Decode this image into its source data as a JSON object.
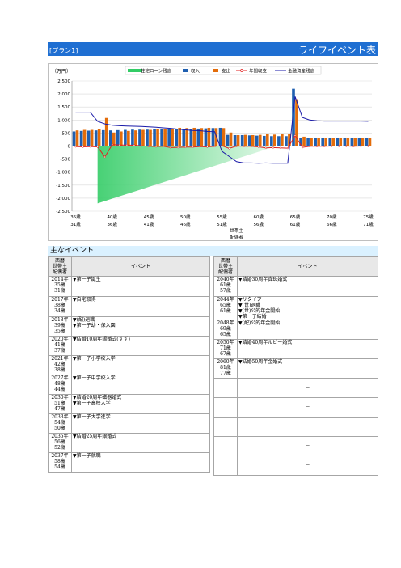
{
  "header": {
    "plan": "[プラン1]",
    "title": "ライフイベント表"
  },
  "chart_data": {
    "type": "bar",
    "yunit": "（万円）",
    "ylim": [
      -2500,
      2500
    ],
    "yticks": [
      "2,500",
      "2,000",
      "1,500",
      "1,000",
      "500",
      "0",
      "-500",
      "-1,000",
      "-1,500",
      "-2,000",
      "-2,500"
    ],
    "x_ticks_row1": [
      "35歳",
      "40歳",
      "45歳",
      "50歳",
      "55歳",
      "60歳",
      "65歳",
      "70歳",
      "75歳"
    ],
    "x_ticks_row2": [
      "31歳",
      "36歳",
      "41歳",
      "46歳",
      "51歳",
      "56歳",
      "61歳",
      "66歳",
      "71歳"
    ],
    "x_axis_label": [
      "世帯主",
      "配偶者"
    ],
    "legend": [
      "住宅ローン残高",
      "収入",
      "支出",
      "年間収支",
      "金融資産残高"
    ],
    "colors": {
      "loan": "#33cc66",
      "income": "#1f5fb0",
      "expense": "#e36c0a",
      "balance": "#e02020",
      "assets": "#1a1aa8"
    },
    "ages": [
      35,
      36,
      37,
      38,
      39,
      40,
      41,
      42,
      43,
      44,
      45,
      46,
      47,
      48,
      49,
      50,
      51,
      52,
      53,
      54,
      55,
      56,
      57,
      58,
      59,
      60,
      61,
      62,
      63,
      64,
      65,
      66,
      67,
      68,
      69,
      70,
      71,
      72,
      73,
      74,
      75
    ],
    "series": [
      {
        "name": "収入",
        "values": [
          560,
          580,
          590,
          600,
          610,
          600,
          610,
          620,
          630,
          630,
          630,
          640,
          640,
          650,
          650,
          660,
          660,
          670,
          680,
          690,
          700,
          430,
          420,
          420,
          410,
          400,
          390,
          380,
          380,
          380,
          2200,
          310,
          300,
          300,
          300,
          300,
          300,
          300,
          300,
          300,
          300
        ]
      },
      {
        "name": "支出",
        "values": [
          600,
          620,
          620,
          640,
          1080,
          520,
          560,
          580,
          600,
          620,
          620,
          640,
          640,
          680,
          700,
          690,
          700,
          690,
          700,
          690,
          690,
          520,
          420,
          430,
          420,
          430,
          460,
          440,
          450,
          460,
          1800,
          360,
          310,
          310,
          310,
          300,
          300,
          300,
          310,
          300,
          300
        ]
      },
      {
        "name": "年間収支",
        "values": [
          -20,
          -30,
          -20,
          -30,
          -420,
          60,
          40,
          40,
          30,
          10,
          -10,
          -20,
          -10,
          -60,
          -50,
          -40,
          -40,
          -20,
          -30,
          -10,
          10,
          -90,
          0,
          -10,
          -10,
          -30,
          -70,
          -60,
          -70,
          -80,
          400,
          -50,
          -10,
          -10,
          -10,
          0,
          0,
          0,
          -10,
          0,
          0
        ]
      },
      {
        "name": "金融資産残高",
        "values": [
          1300,
          1300,
          1300,
          950,
          850,
          800,
          780,
          770,
          760,
          750,
          740,
          720,
          700,
          680,
          650,
          620,
          600,
          590,
          560,
          550,
          -200,
          -400,
          -600,
          -650,
          -650,
          -660,
          -650,
          -660,
          -660,
          -660,
          1900,
          1100,
          1000,
          970,
          960,
          960,
          960,
          960,
          960,
          960,
          950
        ]
      },
      {
        "name": "住宅ローン残高",
        "values": [
          0,
          0,
          0,
          -2200,
          -2110,
          -2020,
          -1930,
          -1840,
          -1750,
          -1660,
          -1570,
          -1480,
          -1390,
          -1300,
          -1210,
          -1120,
          -1030,
          -940,
          -850,
          -760,
          -670,
          -580,
          -490,
          -400,
          -310,
          -220,
          -130,
          -40,
          0,
          0,
          0,
          0,
          0,
          0,
          0,
          0,
          0,
          0,
          0,
          0,
          0
        ]
      }
    ]
  },
  "events": {
    "title": "主なイベント",
    "col_header_year": [
      "西暦",
      "世帯主",
      "配偶者"
    ],
    "col_header_event": "イベント",
    "left": [
      {
        "year": "2014年",
        "h": "35歳",
        "s": "31歳",
        "events": [
          "▼第一子誕生"
        ]
      },
      {
        "year": "2017年",
        "h": "38歳",
        "s": "34歳",
        "events": [
          "▼自宅取得"
        ]
      },
      {
        "year": "2018年",
        "h": "39歳",
        "s": "35歳",
        "events": [
          "▼(配)退職",
          "▼第一子幼・保入園"
        ]
      },
      {
        "year": "2020年",
        "h": "41歳",
        "s": "37歳",
        "events": [
          "▼結婚10周年錫婚式(すず)"
        ]
      },
      {
        "year": "2021年",
        "h": "42歳",
        "s": "38歳",
        "events": [
          "▼第一子小学校入学"
        ]
      },
      {
        "year": "2027年",
        "h": "48歳",
        "s": "44歳",
        "events": [
          "▼第一子中学校入学"
        ]
      },
      {
        "year": "2030年",
        "h": "51歳",
        "s": "47歳",
        "events": [
          "▼結婚20周年磁器婚式",
          "▼第一子高校入学"
        ]
      },
      {
        "year": "2033年",
        "h": "54歳",
        "s": "50歳",
        "events": [
          "▼第一子大学進学"
        ]
      },
      {
        "year": "2035年",
        "h": "56歳",
        "s": "52歳",
        "events": [
          "▼結婚25周年銀婚式"
        ]
      },
      {
        "year": "2037年",
        "h": "58歳",
        "s": "54歳",
        "events": [
          "▼第一子就職"
        ]
      }
    ],
    "right": [
      {
        "year": "2040年",
        "h": "61歳",
        "s": "57歳",
        "events": [
          "▼結婚30周年真珠婚式"
        ]
      },
      {
        "year": "2044年",
        "h": "65歳",
        "s": "61歳",
        "events": [
          "▼リタイア",
          "▼(世)退職",
          "▼(世)公的年金開始",
          "▼第一子結婚"
        ]
      },
      {
        "year": "2048年",
        "h": "69歳",
        "s": "65歳",
        "events": [
          "▼(配)公的年金開始"
        ]
      },
      {
        "year": "2050年",
        "h": "71歳",
        "s": "67歳",
        "events": [
          "▼結婚40周年ルビー婚式"
        ]
      },
      {
        "year": "2060年",
        "h": "81歳",
        "s": "77歳",
        "events": [
          "▼結婚50周年金婚式"
        ]
      },
      {
        "dash": "－"
      },
      {
        "dash": "－"
      },
      {
        "dash": "－"
      },
      {
        "dash": "－"
      },
      {
        "dash": "－"
      }
    ]
  }
}
